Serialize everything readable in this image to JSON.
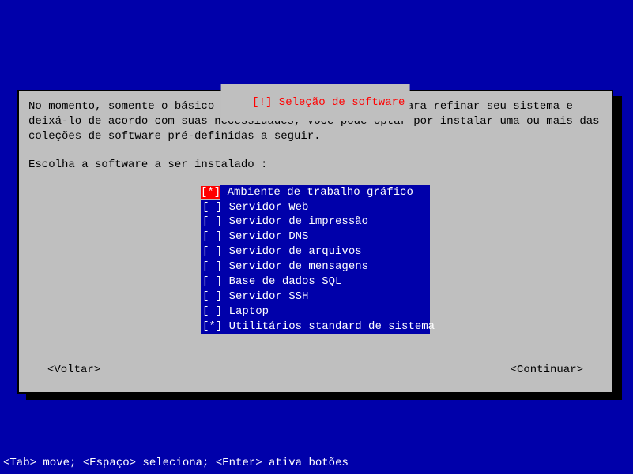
{
  "dialog": {
    "title_prefix": "[!] ",
    "title": "Seleção de software",
    "description": "No momento, somente o básico do sistema está instalado. Para refinar seu sistema e\ndeixá-lo de acordo com suas necessidades, você pode optar por instalar uma ou mais das\ncoleções de software pré-definidas a seguir.",
    "prompt": "Escolha a software a ser instalado :",
    "items": [
      {
        "checked": true,
        "focused": true,
        "label": "Ambiente de trabalho gráfico"
      },
      {
        "checked": false,
        "focused": false,
        "label": "Servidor Web"
      },
      {
        "checked": false,
        "focused": false,
        "label": "Servidor de impressão"
      },
      {
        "checked": false,
        "focused": false,
        "label": "Servidor DNS"
      },
      {
        "checked": false,
        "focused": false,
        "label": "Servidor de arquivos"
      },
      {
        "checked": false,
        "focused": false,
        "label": "Servidor de mensagens"
      },
      {
        "checked": false,
        "focused": false,
        "label": "Base de dados SQL"
      },
      {
        "checked": false,
        "focused": false,
        "label": "Servidor SSH"
      },
      {
        "checked": false,
        "focused": false,
        "label": "Laptop"
      },
      {
        "checked": true,
        "focused": false,
        "label": "Utilitários standard de sistema"
      }
    ],
    "back_label": "<Voltar>",
    "continue_label": "<Continuar>"
  },
  "help_line": "<Tab> move; <Espaço> seleciona; <Enter> ativa botões"
}
